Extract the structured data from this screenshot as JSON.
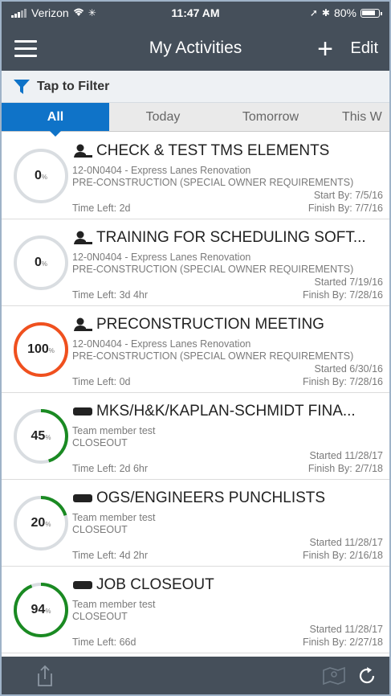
{
  "status": {
    "carrier": "Verizon",
    "time": "11:47 AM",
    "battery": "80%"
  },
  "nav": {
    "title": "My Activities",
    "add_label": "+",
    "edit_label": "Edit"
  },
  "filter": {
    "label": "Tap to Filter"
  },
  "tabs": [
    {
      "label": "All",
      "active": true
    },
    {
      "label": "Today",
      "active": false
    },
    {
      "label": "Tomorrow",
      "active": false
    },
    {
      "label": "This W",
      "active": false
    }
  ],
  "colors": {
    "ring_track": "#d9dde1",
    "ring_red": "#f0501e",
    "ring_green": "#1a8a22",
    "accent": "#0f73c8",
    "bar": "#454f5a"
  },
  "activities": [
    {
      "icon": "person-icon",
      "title": "CHECK & TEST TMS ELEMENTS",
      "line1": "12-0N0404 - Express Lanes Renovation",
      "line2": "PRE-CONSTRUCTION (SPECIAL OWNER REQUIREMENTS)",
      "meta1": "Start By: 7/5/16",
      "meta2": "Finish By: 7/7/16",
      "time_left": "Time Left: 2d",
      "percent": 0,
      "percent_text": "0",
      "unit": "%",
      "color": "#d9dde1"
    },
    {
      "icon": "person-icon",
      "title": "TRAINING FOR SCHEDULING SOFT...",
      "line1": "12-0N0404 - Express Lanes Renovation",
      "line2": "PRE-CONSTRUCTION (SPECIAL OWNER REQUIREMENTS)",
      "meta1": "Started 7/19/16",
      "meta2": "Finish By: 7/28/16",
      "time_left": "Time Left: 3d 4hr",
      "percent": 0,
      "percent_text": "0",
      "unit": "%",
      "color": "#d9dde1"
    },
    {
      "icon": "person-icon",
      "title": "PRECONSTRUCTION MEETING",
      "line1": "12-0N0404 - Express Lanes Renovation",
      "line2": "PRE-CONSTRUCTION (SPECIAL OWNER REQUIREMENTS)",
      "meta1": "Started 6/30/16",
      "meta2": "Finish By: 7/28/16",
      "time_left": "Time Left: 0d",
      "percent": 100,
      "percent_text": "100",
      "unit": "%",
      "color": "#f0501e"
    },
    {
      "icon": "team-icon",
      "title": "MKS/H&K/KAPLAN-SCHMIDT FINA...",
      "line1": "Team member test",
      "line2": "CLOSEOUT",
      "meta1": "Started 11/28/17",
      "meta2": "Finish By: 2/7/18",
      "time_left": "Time Left: 2d 6hr",
      "percent": 45,
      "percent_text": "45",
      "unit": "%",
      "color": "#1a8a22"
    },
    {
      "icon": "team-icon",
      "title": "OGS/ENGINEERS PUNCHLISTS",
      "line1": "Team member test",
      "line2": "CLOSEOUT",
      "meta1": "Started 11/28/17",
      "meta2": "Finish By: 2/16/18",
      "time_left": "Time Left: 4d 2hr",
      "percent": 20,
      "percent_text": "20",
      "unit": "%",
      "color": "#1a8a22"
    },
    {
      "icon": "team-icon",
      "title": "JOB CLOSEOUT",
      "line1": "Team member test",
      "line2": "CLOSEOUT",
      "meta1": "Started 11/28/17",
      "meta2": "Finish By: 2/27/18",
      "time_left": "Time Left: 66d",
      "percent": 94,
      "percent_text": "94",
      "unit": "%",
      "color": "#1a8a22"
    }
  ]
}
